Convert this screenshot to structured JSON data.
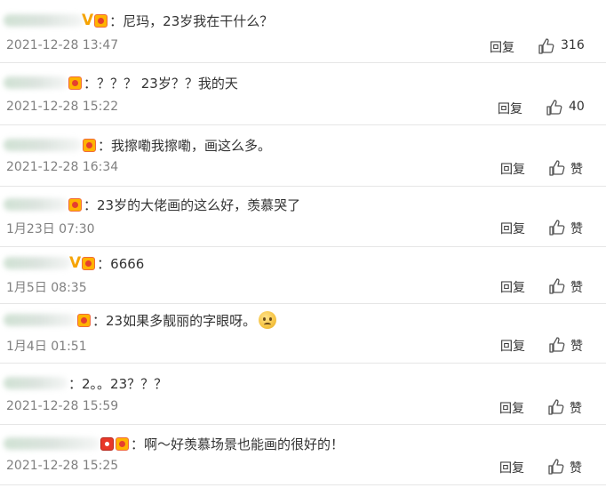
{
  "reply_label": "回复",
  "comments": [
    {
      "text": "：尼玛，23岁我在干什么？",
      "time": "2021-12-28 13:47",
      "likes": "316"
    },
    {
      "text": "：？？？ 23岁？？我的天",
      "time": "2021-12-28 15:22",
      "likes": "40"
    },
    {
      "text": "：我擦嘞我擦嘞，画这么多。",
      "time": "2021-12-28 16:34",
      "likes": "赞"
    },
    {
      "text": "：23岁的大佬画的这么好，羡慕哭了",
      "time": "1月23日 07:30",
      "likes": "赞"
    },
    {
      "text": "：6666",
      "time": "1月5日 08:35",
      "likes": "赞"
    },
    {
      "text": "：23如果多靓丽的字眼呀。",
      "time": "1月4日 01:51",
      "likes": "赞"
    },
    {
      "text": "：2。。23？？？",
      "time": "2021-12-28 15:59",
      "likes": "赞"
    },
    {
      "text": "：啊～好羡慕场景也能画的很好的！",
      "time": "2021-12-28 15:25",
      "likes": "赞"
    }
  ]
}
